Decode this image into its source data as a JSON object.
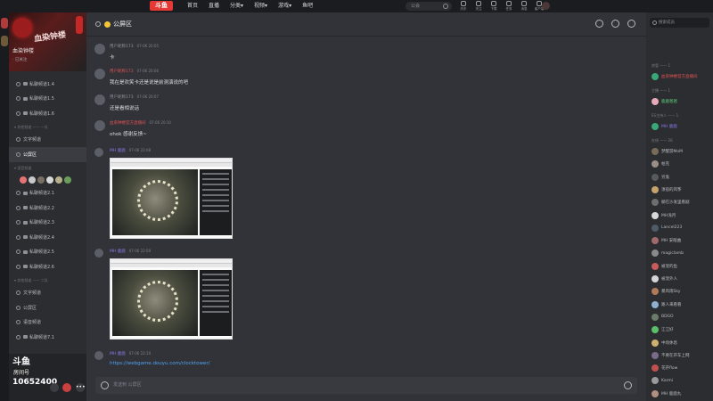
{
  "topbar": {
    "logo": "斗鱼",
    "nav": [
      "首页",
      "直播",
      "分类▾",
      "视频▾",
      "游戏▾",
      "鱼吧"
    ],
    "search_placeholder": "公会",
    "tools": [
      "历史",
      "关注",
      "下载",
      "任务",
      "消息",
      "客户端"
    ]
  },
  "server": {
    "name": "血染钟楼",
    "sub": "· 已关注"
  },
  "channels": {
    "items_top": [
      "私聊频道1.4",
      "私聊频道1.5",
      "私聊频道1.6"
    ],
    "category_1": "▾ 其他频道 —— 一队",
    "items_mid": [
      "文字频道",
      "公屏区"
    ],
    "category_2": "▾ 语音频道",
    "items_voice": [
      "私聊频道2.1",
      "私聊频道2.2",
      "私聊频道2.3",
      "私聊频道2.4",
      "私聊频道2.5",
      "私聊频道2.6"
    ],
    "category_3": "▾ 其他频道 —— 二队",
    "items_bottom": [
      "文字频道",
      "公屏区",
      "语音频道",
      "私聊频道7.1"
    ]
  },
  "player": {
    "brand": "斗鱼",
    "room_label": "房间号",
    "room_id": "10652400"
  },
  "chat": {
    "channel_name": "公屏区",
    "messages": [
      {
        "name": "用户昵称173",
        "time": "07-06 20:05",
        "text": "卡",
        "name_color": "#8e9198"
      },
      {
        "name": "用户昵称173",
        "time": "07-06 20:06",
        "text": "我在是欢笑卡还是说是前测演说的吧",
        "name_color": "#8e9198"
      },
      {
        "name": "用户昵称173",
        "time": "07-06 20:07",
        "text": "还是看相说话",
        "name_color": "#8e9198"
      },
      {
        "name": "血染钟楼官方直播间",
        "time": "07-06 20:10",
        "text": "ohok 感谢反馈~",
        "name_color": "#e05252"
      },
      {
        "name": "MH 鹿鹿",
        "time": "07-06 22:08",
        "text": "",
        "name_color": "#8c7ae6"
      },
      {
        "name": "MH 鹿鹿",
        "time": "07-06 22:09",
        "text": "",
        "name_color": "#8c7ae6"
      },
      {
        "name": "MH 鹿鹿",
        "time": "07-06 22:10",
        "text": "https://webgame.douyu.com/clocktower/",
        "name_color": "#8c7ae6"
      }
    ],
    "composer_placeholder": "发送到 公屏区"
  },
  "members": {
    "search_placeholder": "搜索成员",
    "cat_1": "房管 —— 1",
    "m1": "血染钟楼官方直播间",
    "cat_2": "主播 —— 1",
    "m2": "鹿鹿爸爸",
    "cat_3": "ES主持人 —— 1",
    "m3": "MH 鹿鹿",
    "cat_4": "在线 —— 26",
    "list": [
      "梦醒游MoM",
      "帕克",
      "穷鬼",
      "须宿的风筝",
      "躺在沙发里看剧",
      "MH浅月",
      "Lancel223",
      "MH 安眠曲",
      "magiclamb",
      "被宠的鱼",
      "被宠外人",
      "暴风雨Sky",
      "路人来看看",
      "BDGO",
      "江江好",
      "中场休息",
      "不要在开车上网",
      "花开flow",
      "Karmi",
      "MH 鹿鹿丸"
    ]
  }
}
